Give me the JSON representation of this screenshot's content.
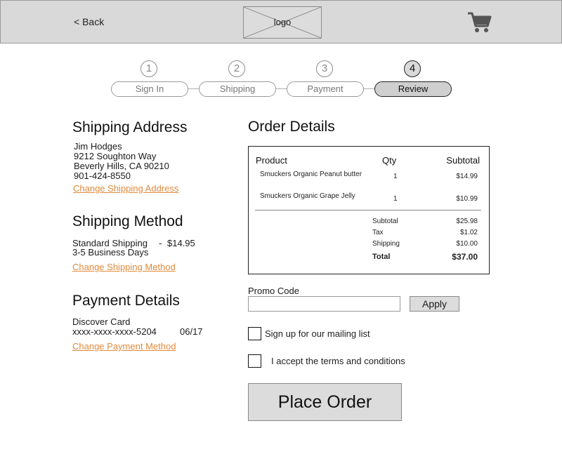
{
  "header": {
    "back_label": "< Back",
    "logo_label": "logo",
    "cart_icon": "shopping-cart-icon"
  },
  "steps": [
    {
      "number": "1",
      "label": "Sign In",
      "active": false
    },
    {
      "number": "2",
      "label": "Shipping",
      "active": false
    },
    {
      "number": "3",
      "label": "Payment",
      "active": false
    },
    {
      "number": "4",
      "label": "Review",
      "active": true
    }
  ],
  "shipping_address": {
    "title": "Shipping Address",
    "name": "Jim Hodges",
    "street": "9212 Soughton Way",
    "city": "Beverly Hills, CA 90210",
    "phone": "901-424-8550",
    "change_link": "Change Shipping Address"
  },
  "shipping_method": {
    "title": "Shipping Method",
    "method": "Standard Shipping",
    "separator": "-",
    "price": "$14.95",
    "eta": "3-5 Business Days",
    "change_link": "Change Shipping Method"
  },
  "payment_details": {
    "title": "Payment Details",
    "card": "Discover Card",
    "number": "xxxx-xxxx-xxxx-5204",
    "expiry": "06/17",
    "change_link": "Change Payment Method"
  },
  "order_details": {
    "title": "Order Details",
    "columns": {
      "product": "Product",
      "qty": "Qty",
      "subtotal": "Subtotal"
    },
    "items": [
      {
        "product": "Smuckers Organic Peanut butter",
        "qty": "1",
        "subtotal": "$14.99"
      },
      {
        "product": "Smuckers Organic Grape Jelly",
        "qty": "1",
        "subtotal": "$10.99"
      }
    ],
    "totals": [
      {
        "label": "Subtotal",
        "value": "$25.98"
      },
      {
        "label": "Tax",
        "value": "$1.02"
      },
      {
        "label": "Shipping",
        "value": "$10.00"
      },
      {
        "label": "Total",
        "value": "$37.00"
      }
    ]
  },
  "promo": {
    "label": "Promo Code",
    "value": "",
    "placeholder": "",
    "apply_label": "Apply"
  },
  "checkboxes": {
    "mailing_list": "Sign up for our mailing list",
    "terms": "I accept the terms and conditions"
  },
  "place_order_label": "Place Order",
  "colors": {
    "link": "#e08a3c",
    "header_bg": "#d9d9d9",
    "active_step_bg": "#cfcfcf"
  }
}
